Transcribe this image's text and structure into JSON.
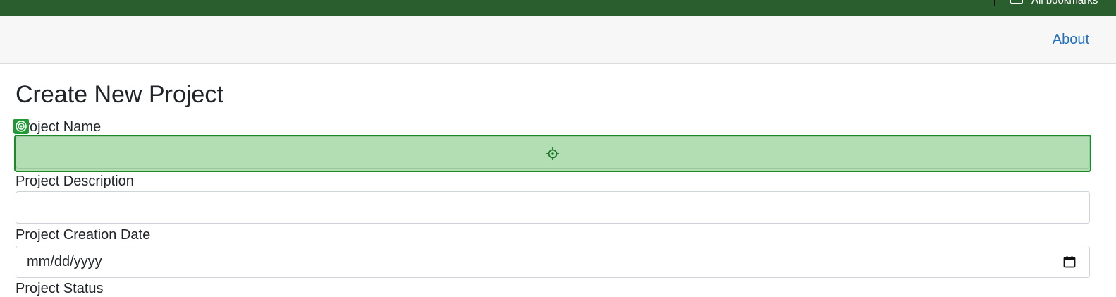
{
  "browser": {
    "bookmarks_label": "All bookmarks"
  },
  "navbar": {
    "about_label": "About"
  },
  "form": {
    "title": "Create New Project",
    "fields": [
      {
        "label": "Project Name",
        "value": "",
        "placeholder": ""
      },
      {
        "label": "Project Description",
        "value": "",
        "placeholder": ""
      },
      {
        "label": "Project Creation Date",
        "value": "",
        "placeholder": "mm/dd/yyyy"
      },
      {
        "label": "Project Status"
      }
    ]
  },
  "icons": {
    "target_badge": "target-icon",
    "crosshair": "crosshair-icon",
    "calendar": "calendar-icon",
    "bookmarks_folder": "folder-icon"
  },
  "colors": {
    "browser_bar": "#2b5e2e",
    "navbar_bg": "#f7f7f7",
    "link": "#1f6fc3",
    "highlight_border": "#1b8a2a",
    "highlight_fill": "#b3dcb3"
  }
}
